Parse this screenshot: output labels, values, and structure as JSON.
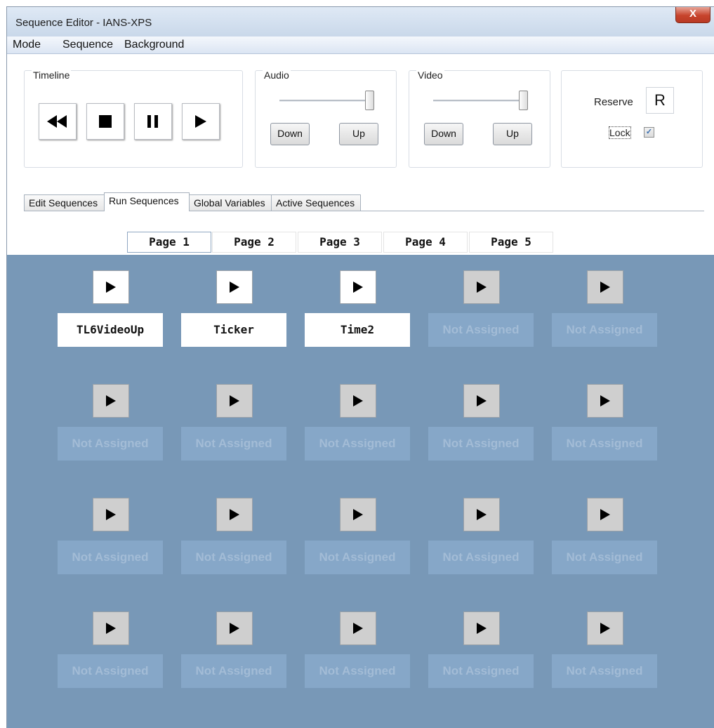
{
  "window": {
    "title": "Sequence Editor - IANS-XPS",
    "close_label": "X"
  },
  "menu": [
    "Mode",
    "Sequence",
    "Background"
  ],
  "timeline": {
    "label": "Timeline",
    "buttons": [
      "rewind-icon",
      "stop-icon",
      "pause-icon",
      "play-icon"
    ]
  },
  "audio": {
    "label": "Audio",
    "down": "Down",
    "up": "Up",
    "level": 1.0
  },
  "video": {
    "label": "Video",
    "down": "Down",
    "up": "Up",
    "level": 1.0
  },
  "reserve": {
    "label": "Reserve",
    "button": "R",
    "lock_label": "Lock",
    "lock_checked": true
  },
  "tabs": [
    "Edit Sequences",
    "Run Sequences",
    "Global Variables",
    "Active Sequences"
  ],
  "active_tab": "Run Sequences",
  "pages": [
    "Page 1",
    "Page 2",
    "Page 3",
    "Page 4",
    "Page 5"
  ],
  "active_page": "Page 1",
  "sequences": [
    [
      "TL6VideoUp",
      "Ticker",
      "Time2",
      "Not Assigned",
      "Not Assigned"
    ],
    [
      "Not Assigned",
      "Not Assigned",
      "Not Assigned",
      "Not Assigned",
      "Not Assigned"
    ],
    [
      "Not Assigned",
      "Not Assigned",
      "Not Assigned",
      "Not Assigned",
      "Not Assigned"
    ],
    [
      "Not Assigned",
      "Not Assigned",
      "Not Assigned",
      "Not Assigned",
      "Not Assigned"
    ]
  ],
  "colors": {
    "grid_bg": "#7898b7",
    "unassigned_label": "#86a7c8",
    "checkbox": "#3a6fb0"
  }
}
